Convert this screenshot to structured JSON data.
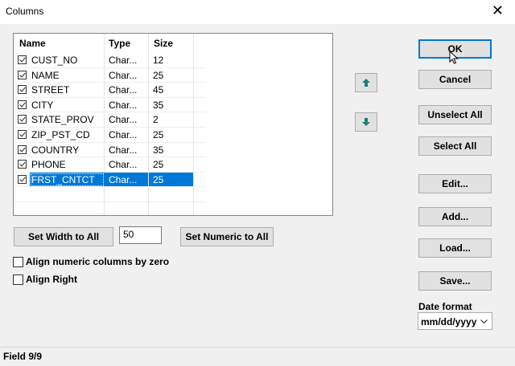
{
  "window": {
    "title": "Columns",
    "close": "✕"
  },
  "list": {
    "headers": [
      "Name",
      "Type",
      "Size"
    ],
    "rows": [
      {
        "name": "CUST_NO",
        "type": "Char...",
        "size": "12"
      },
      {
        "name": "NAME",
        "type": "Char...",
        "size": "25"
      },
      {
        "name": "STREET",
        "type": "Char...",
        "size": "45"
      },
      {
        "name": "CITY",
        "type": "Char...",
        "size": "35"
      },
      {
        "name": "STATE_PROV",
        "type": "Char...",
        "size": "2"
      },
      {
        "name": "ZIP_PST_CD",
        "type": "Char...",
        "size": "25"
      },
      {
        "name": "COUNTRY",
        "type": "Char...",
        "size": "35"
      },
      {
        "name": "PHONE",
        "type": "Char...",
        "size": "25"
      },
      {
        "name": "FRST_CNTCT",
        "type": "Char...",
        "size": "25"
      }
    ],
    "selected_index": 8
  },
  "buttons": {
    "ok": "OK",
    "cancel": "Cancel",
    "unselect_all": "Unselect All",
    "select_all": "Select All",
    "edit": "Edit...",
    "add": "Add...",
    "load": "Load...",
    "save": "Save...",
    "set_width": "Set Width to All",
    "set_numeric": "Set Numeric to All"
  },
  "width_value": "50",
  "options": {
    "align_zero": "Align numeric columns by zero",
    "align_right": "Align Right"
  },
  "date_format": {
    "label": "Date format",
    "value": "mm/dd/yyyy"
  },
  "status": "Field 9/9",
  "colors": {
    "accent": "#0078d7",
    "button_face": "#e1e1e1",
    "arrow": "#1e7f76"
  },
  "icons": [
    "close-icon",
    "move-up-icon",
    "move-down-icon",
    "checkbox-checked-icon",
    "chevron-down-icon",
    "mouse-cursor-icon"
  ]
}
